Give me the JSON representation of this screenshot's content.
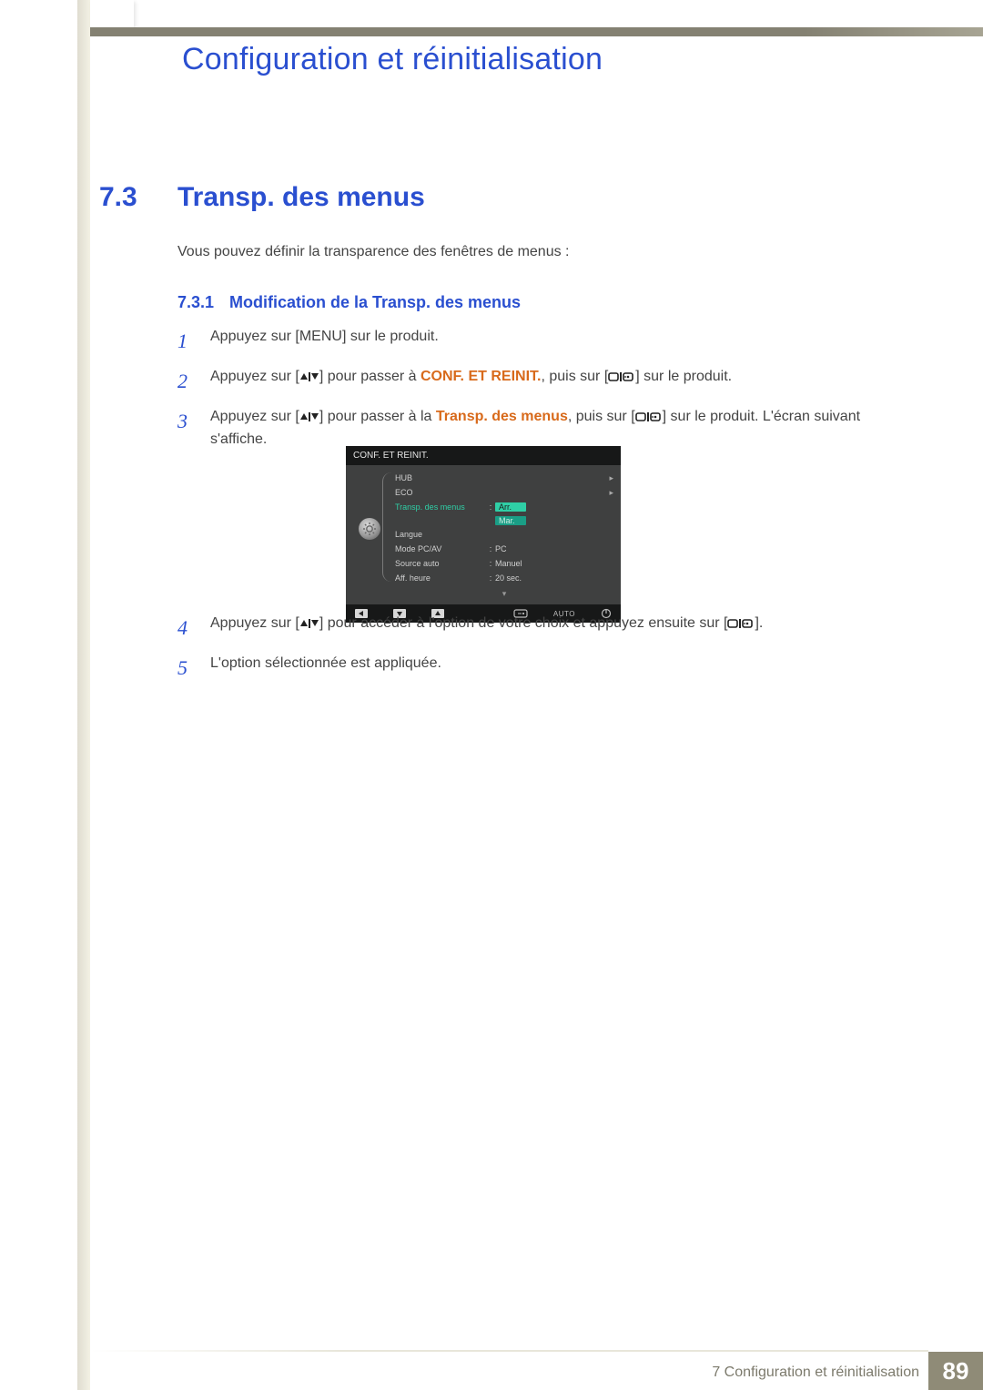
{
  "header": {
    "main_title": "Configuration et réinitialisation"
  },
  "section": {
    "num": "7.3",
    "title": "Transp. des menus",
    "intro": "Vous pouvez définir la transparence des fenêtres de menus :"
  },
  "subsection": {
    "num": "7.3.1",
    "title": "Modification de la Transp. des menus"
  },
  "steps": {
    "s1": {
      "n": "1",
      "pre": "Appuyez sur [",
      "menu": "MENU",
      "post": "] sur le produit."
    },
    "s2": {
      "n": "2",
      "pre": "Appuyez sur [",
      "mid1": "] pour passer à ",
      "target": "CONF. ET REINIT.",
      "mid2": ", puis sur [",
      "post": "] sur le produit."
    },
    "s3": {
      "n": "3",
      "pre": "Appuyez sur [",
      "mid1": "] pour passer à la ",
      "target": "Transp. des menus",
      "mid2": ", puis sur [",
      "post": "] sur le produit. L'écran suivant s'affiche."
    },
    "s4": {
      "n": "4",
      "pre": "Appuyez sur [",
      "mid1": "] pour accéder à l'option de votre choix et appuyez ensuite sur [",
      "post": "]."
    },
    "s5": {
      "n": "5",
      "text": "L'option sélectionnée est appliquée."
    }
  },
  "osd": {
    "title": "CONF. ET REINIT.",
    "rows": {
      "hub": {
        "label": "HUB"
      },
      "eco": {
        "label": "ECO"
      },
      "trans": {
        "label": "Transp. des menus",
        "opt_off": "Arr.",
        "opt_on": "Mar."
      },
      "lang": {
        "label": "Langue"
      },
      "pcav": {
        "label": "Mode PC/AV",
        "value": "PC"
      },
      "src": {
        "label": "Source auto",
        "value": "Manuel"
      },
      "time": {
        "label": "Aff. heure",
        "value": "20 sec."
      }
    },
    "footer_auto": "AUTO"
  },
  "footer": {
    "label": "7 Configuration et réinitialisation",
    "page": "89"
  }
}
